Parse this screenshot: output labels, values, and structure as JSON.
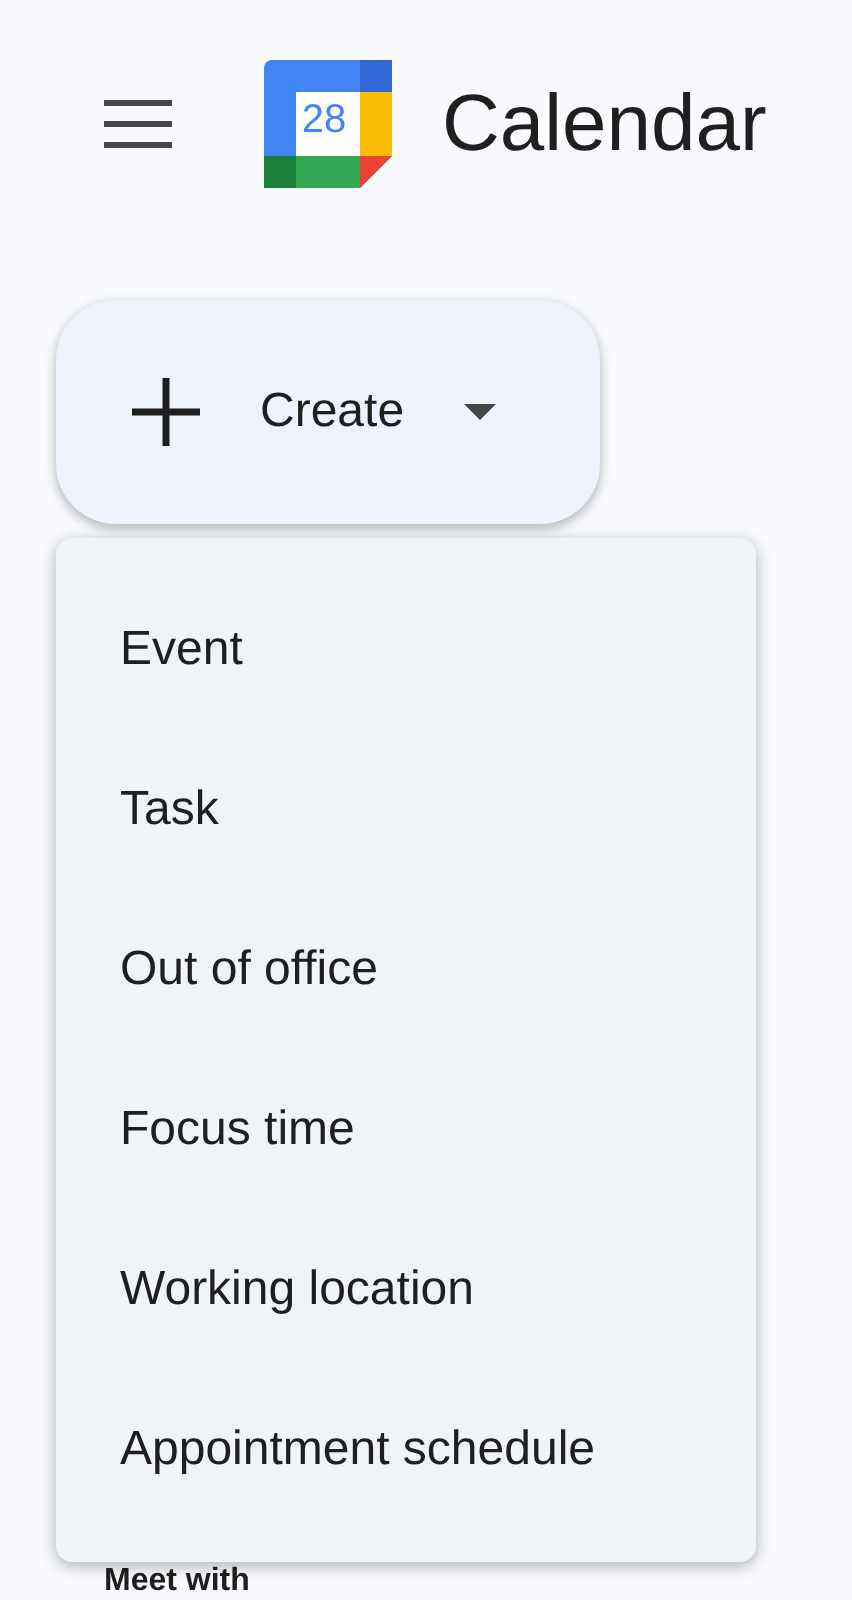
{
  "header": {
    "logo_date": "28",
    "title": "Calendar"
  },
  "create_button": {
    "label": "Create"
  },
  "menu": {
    "items": [
      {
        "label": "Event"
      },
      {
        "label": "Task"
      },
      {
        "label": "Out of office"
      },
      {
        "label": "Focus time"
      },
      {
        "label": "Working location"
      },
      {
        "label": "Appointment schedule"
      }
    ]
  },
  "section_heading": "Meet with"
}
